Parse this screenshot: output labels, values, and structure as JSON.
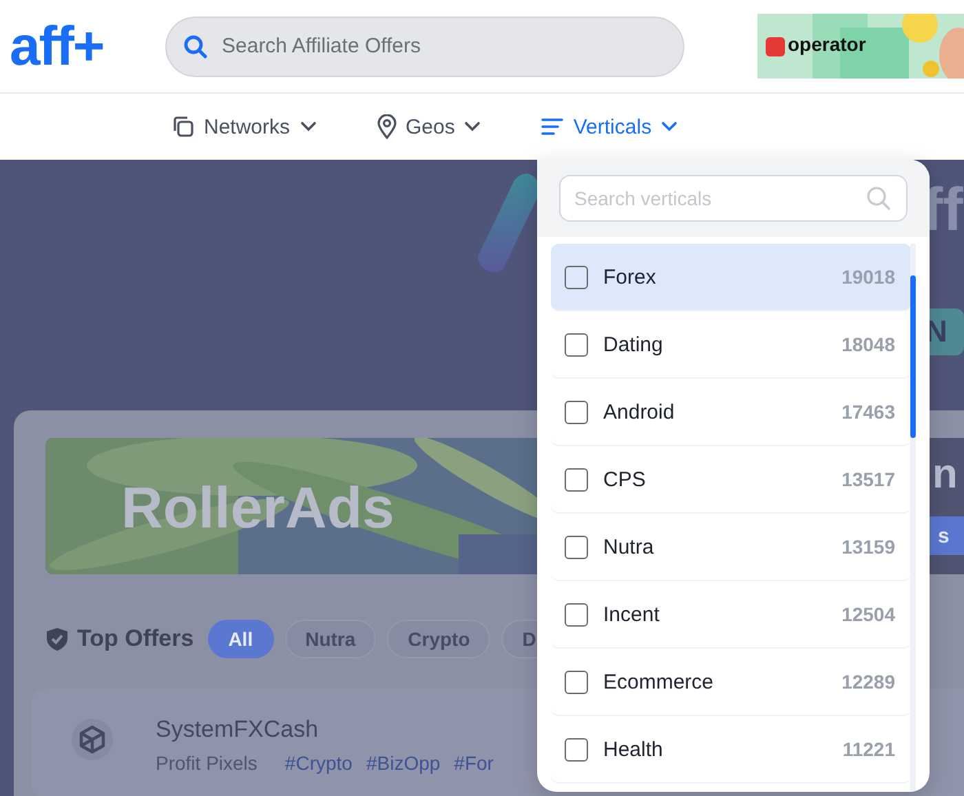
{
  "logo": {
    "text": "aff+"
  },
  "search": {
    "placeholder": "Search Affiliate Offers"
  },
  "ad": {
    "text": "operator"
  },
  "nav": [
    {
      "label": "Networks",
      "selected": false
    },
    {
      "label": "Geos",
      "selected": false
    },
    {
      "label": "Verticals",
      "selected": true
    }
  ],
  "hero": {
    "title_fragment": "ff",
    "button_fragment": "N"
  },
  "banner": {
    "brand": "RollerAds",
    "title_fragment": "n",
    "button_fragment": "s"
  },
  "top_offers": {
    "title": "Top Offers",
    "filters": [
      {
        "label": "All",
        "selected": true
      },
      {
        "label": "Nutra",
        "selected": false
      },
      {
        "label": "Crypto",
        "selected": false
      },
      {
        "label": "D",
        "selected": false
      }
    ]
  },
  "offers": [
    {
      "name": "SystemFXCash",
      "network": "Profit Pixels",
      "tags": [
        "#Crypto",
        "#BizOpp",
        "#For"
      ]
    }
  ],
  "verticals_dropdown": {
    "placeholder": "Search verticals",
    "items": [
      {
        "label": "Forex",
        "count": "19018",
        "checked": false,
        "selected": true
      },
      {
        "label": "Dating",
        "count": "18048",
        "checked": false,
        "selected": false
      },
      {
        "label": "Android",
        "count": "17463",
        "checked": false,
        "selected": false
      },
      {
        "label": "CPS",
        "count": "13517",
        "checked": false,
        "selected": false
      },
      {
        "label": "Nutra",
        "count": "13159",
        "checked": false,
        "selected": false
      },
      {
        "label": "Incent",
        "count": "12504",
        "checked": false,
        "selected": false
      },
      {
        "label": "Ecommerce",
        "count": "12289",
        "checked": false,
        "selected": false
      },
      {
        "label": "Health",
        "count": "11221",
        "checked": false,
        "selected": false
      }
    ]
  }
}
